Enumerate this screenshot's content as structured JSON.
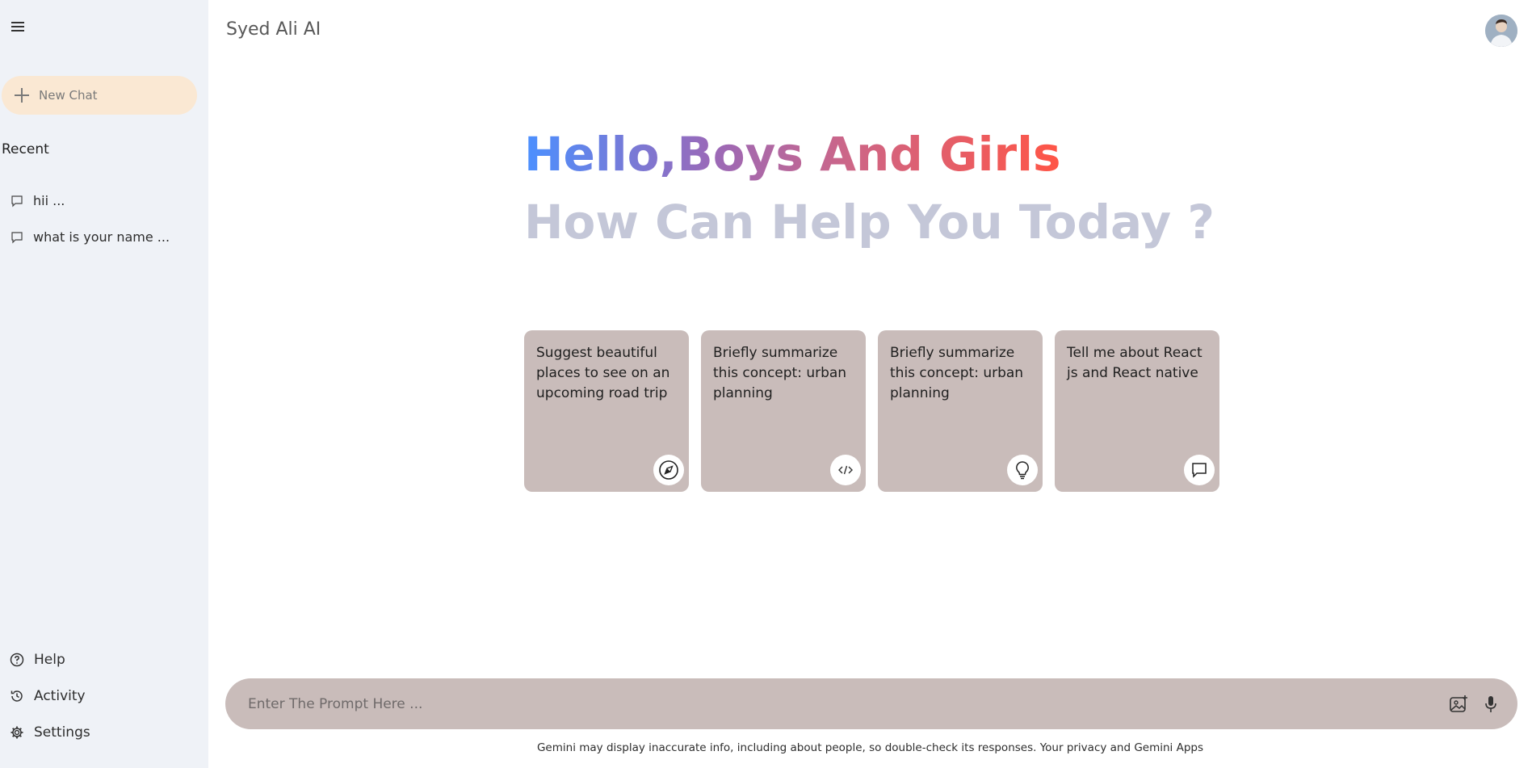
{
  "sidebar": {
    "new_chat_label": "New Chat",
    "recent_title": "Recent",
    "recent_items": [
      {
        "label": "hii ..."
      },
      {
        "label": "what is your name ..."
      }
    ],
    "bottom_items": [
      {
        "label": "Help",
        "icon": "help-circle-icon"
      },
      {
        "label": "Activity",
        "icon": "history-icon"
      },
      {
        "label": "Settings",
        "icon": "gear-icon"
      }
    ]
  },
  "header": {
    "title": "Syed Ali AI"
  },
  "greeting": {
    "line1": "Hello,Boys And Girls",
    "line2": "How Can Help You Today ?"
  },
  "cards": [
    {
      "text": "Suggest beautiful places to see on an upcoming road trip",
      "icon": "compass-icon"
    },
    {
      "text": "Briefly summarize this concept: urban planning",
      "icon": "code-icon"
    },
    {
      "text": "Briefly summarize this concept: urban planning",
      "icon": "bulb-icon"
    },
    {
      "text": "Tell me about React js and React native",
      "icon": "message-icon"
    }
  ],
  "prompt": {
    "placeholder": "Enter The Prompt Here ..."
  },
  "footer": {
    "note": "Gemini may display inaccurate info, including about people, so double-check its responses. Your privacy and Gemini Apps"
  },
  "colors": {
    "sidebar_bg": "#eff2f7",
    "new_chat_bg": "#fae8d3",
    "card_bg": "#c9bcba",
    "prompt_bg": "#c9bcba",
    "greeting_gradient_start": "#4b90ff",
    "greeting_gradient_end": "#ff5546",
    "subtitle_color": "#c4c7d8"
  }
}
